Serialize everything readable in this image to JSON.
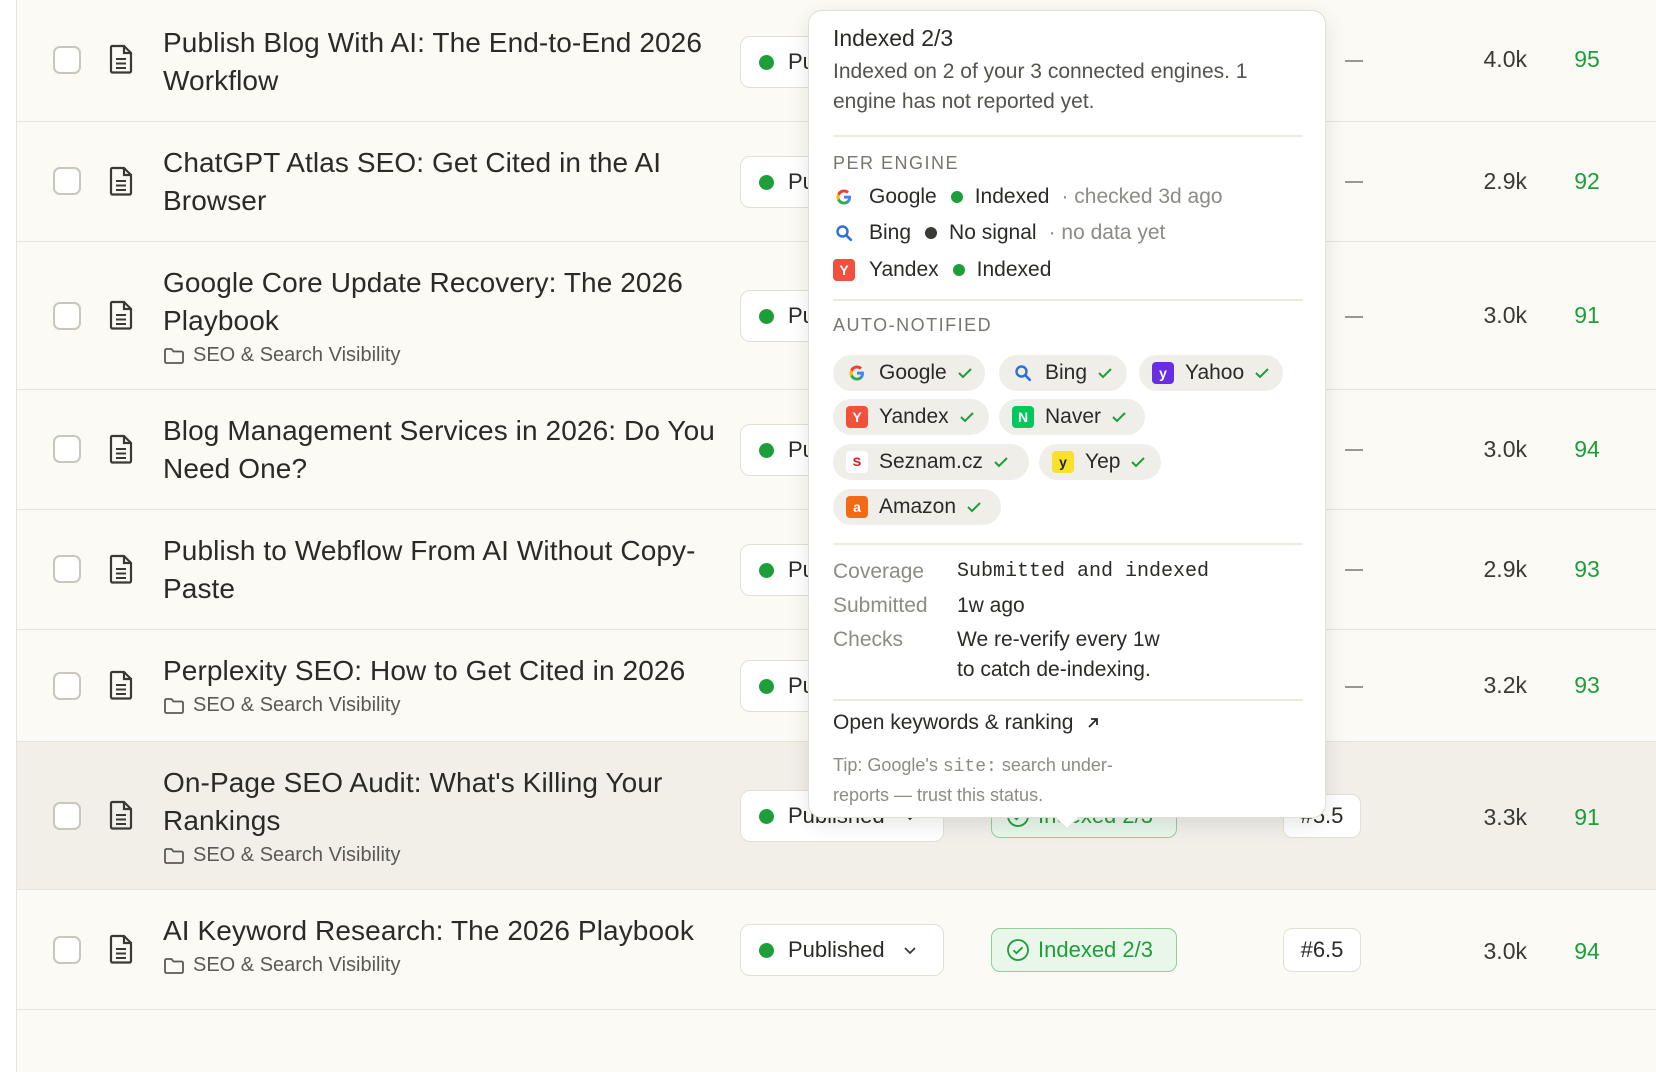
{
  "rows": [
    {
      "title": "Publish Blog With AI: The End-to-End 2026 Workflow",
      "category": "",
      "status": "Pu",
      "words": "4.0k",
      "score": "95"
    },
    {
      "title": "ChatGPT Atlas SEO: Get Cited in the AI Browser",
      "category": "",
      "status": "Pu",
      "words": "2.9k",
      "score": "92"
    },
    {
      "title": "Google Core Update Recovery: The 2026 Playbook",
      "category": "SEO & Search Visibility",
      "status": "Pu",
      "words": "3.0k",
      "score": "91"
    },
    {
      "title": "Blog Management Services in 2026: Do You Need One?",
      "category": "",
      "status": "Pu",
      "words": "3.0k",
      "score": "94"
    },
    {
      "title": "Publish to Webflow From AI Without Copy-Paste",
      "category": "",
      "status": "Pu",
      "words": "2.9k",
      "score": "93"
    },
    {
      "title": "Perplexity SEO: How to Get Cited in 2026",
      "category": "SEO & Search Visibility",
      "status": "Pu",
      "words": "3.2k",
      "score": "93"
    },
    {
      "title": "On-Page SEO Audit: What's Killing Your Rankings",
      "category": "SEO & Search Visibility",
      "status": "Published",
      "index": "Indexed 2/3",
      "rank": "#5.5",
      "words": "3.3k",
      "score": "91"
    },
    {
      "title": "AI Keyword Research: The 2026 Playbook",
      "category": "SEO & Search Visibility",
      "status": "Published",
      "index": "Indexed 2/3",
      "rank": "#6.5",
      "words": "3.0k",
      "score": "94"
    }
  ],
  "popover": {
    "title": "Indexed 2/3",
    "description": "Indexed on 2 of your 3 connected engines. 1 engine has not reported yet.",
    "per_engine_label": "PER ENGINE",
    "engines": [
      {
        "name": "Google",
        "state": "Indexed",
        "note": "· checked 3d ago",
        "dot": "#1e9e3a"
      },
      {
        "name": "Bing",
        "state": "No signal",
        "note": "· no data yet",
        "dot": "#3a3934"
      },
      {
        "name": "Yandex",
        "state": "Indexed",
        "note": "",
        "dot": "#1e9e3a"
      }
    ],
    "auto_notified_label": "AUTO-NOTIFIED",
    "notified": [
      "Google",
      "Bing",
      "Yahoo",
      "Yandex",
      "Naver",
      "Seznam.cz",
      "Yep",
      "Amazon"
    ],
    "coverage_label": "Coverage",
    "coverage_value": "Submitted and indexed",
    "submitted_label": "Submitted",
    "submitted_value": "1w ago",
    "checks_label": "Checks",
    "checks_value_1": "We re-verify every 1w",
    "checks_value_2": "to catch de-indexing.",
    "open_link": "Open keywords & ranking",
    "tip_prefix": "Tip: Google's ",
    "tip_code": "site:",
    "tip_rest_1": " search under-",
    "tip_rest_2": "reports — trust this status."
  },
  "colors": {
    "accent_green": "#1e9e3a",
    "row_bg": "#fbfaf4",
    "hover_bg": "#f1efe8"
  }
}
